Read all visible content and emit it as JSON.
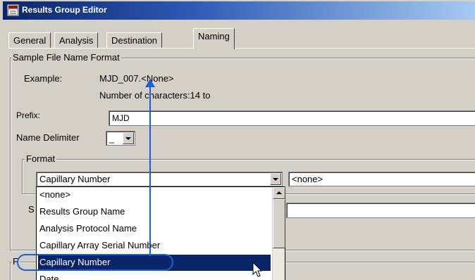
{
  "window": {
    "title": "Results Group Editor"
  },
  "tabs": [
    {
      "label": "General"
    },
    {
      "label": "Analysis"
    },
    {
      "label": "Destination"
    },
    {
      "label": "Naming",
      "active": true
    }
  ],
  "sample_file_name_format": {
    "group_label": "Sample File Name Format",
    "example_label": "Example:",
    "example_value": "MJD_007.<None>",
    "number_of_characters": "Number of characters:14 to",
    "prefix_label": "Prefix:",
    "prefix_value": "MJD",
    "name_delimiter_label": "Name Delimiter",
    "name_delimiter_value": "_",
    "format": {
      "group_label": "Format",
      "field1_value": "Capillary Number",
      "field2_value": "<none>"
    },
    "partial_label_s": "S",
    "partial_label_f": "F"
  },
  "dropdown": {
    "items": [
      {
        "label": "<none>"
      },
      {
        "label": "Results Group Name"
      },
      {
        "label": "Analysis Protocol Name"
      },
      {
        "label": "Capillary Array Serial Number"
      },
      {
        "label": "Capillary Number",
        "selected": true
      },
      {
        "label": "Date"
      }
    ]
  },
  "colors": {
    "title_bar": "#0a246a",
    "selection": "#0a246a",
    "annotation": "#1c5fd0",
    "face": "#d4d0c8"
  },
  "icons": {
    "app": "results-group-icon",
    "cursor": "arrow-cursor-icon"
  }
}
